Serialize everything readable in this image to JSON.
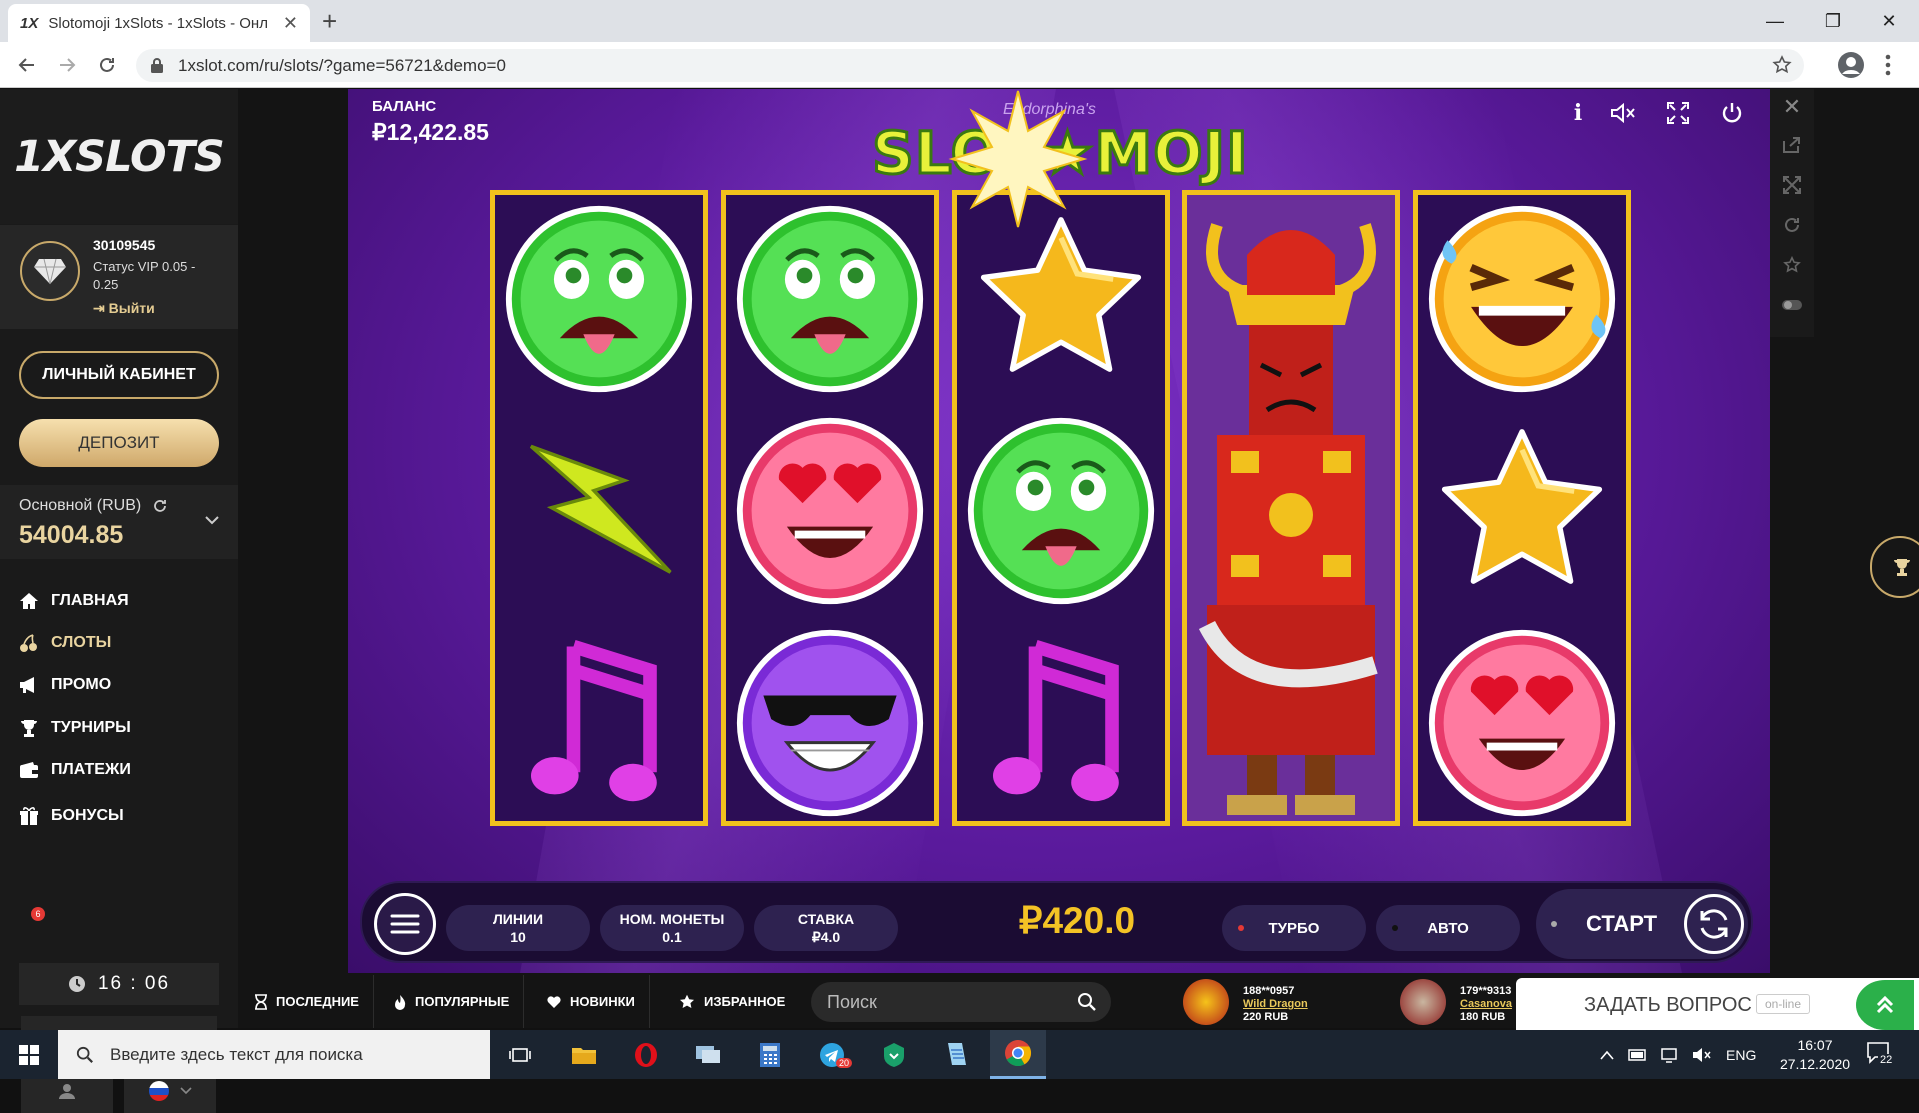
{
  "browser": {
    "tab_title": "Slotomoji 1xSlots - 1xSlots - Онл",
    "tab_favicon": "1X",
    "url": "1xslot.com/ru/slots/?game=56721&demo=0"
  },
  "site": {
    "logo": "1XSLOTS",
    "user": {
      "id": "30109545",
      "status": "Статус VIP 0.05 - 0.25",
      "logout": "Выйти"
    },
    "cabinet_button": "ЛИЧНЫЙ КАБИНЕТ",
    "deposit_button": "ДЕПОЗИТ",
    "account": {
      "label": "Основной (RUB)",
      "balance": "54004.85"
    },
    "nav": [
      {
        "label": "ГЛАВНАЯ",
        "icon": "home-icon"
      },
      {
        "label": "СЛОТЫ",
        "icon": "cherries-icon"
      },
      {
        "label": "ПРОМО",
        "icon": "megaphone-icon"
      },
      {
        "label": "ТУРНИРЫ",
        "icon": "trophy-icon"
      },
      {
        "label": "ПЛАТЕЖИ",
        "icon": "wallet-icon"
      },
      {
        "label": "БОНУСЫ",
        "icon": "gift-icon"
      }
    ],
    "bonus_badge": "6",
    "clock": {
      "hours": "16",
      "sep": ":",
      "minutes": "06"
    }
  },
  "game": {
    "balance_label": "БАЛАНС",
    "balance_value": "₽12,422.85",
    "title": "SLOT★MOJI",
    "subtitle": "Endorphina's",
    "reels": [
      [
        "sick-green-emoji",
        "lightning-symbol",
        "music-note-symbol"
      ],
      [
        "sick-green-emoji",
        "heart-eyes-emoji",
        "sunglasses-emoji"
      ],
      [
        "star-symbol",
        "sick-green-emoji",
        "music-note-symbol"
      ],
      [
        "samurai-wild"
      ],
      [
        "laughing-emoji",
        "star-symbol",
        "heart-eyes-emoji"
      ]
    ],
    "lines": {
      "label": "ЛИНИИ",
      "value": "10"
    },
    "coin": {
      "label": "НОМ. МОНЕТЫ",
      "value": "0.1"
    },
    "stake": {
      "label": "СТАВКА",
      "value": "₽4.0"
    },
    "total_bet": "₽420.0",
    "turbo": "ТУРБО",
    "auto": "АВТО",
    "start": "СТАРТ"
  },
  "bottom": {
    "tabs": [
      "ПОСЛЕДНИЕ",
      "ПОПУЛЯРНЫЕ",
      "НОВИНКИ",
      "ИЗБРАННОЕ"
    ],
    "search_placeholder": "Поиск",
    "winners": [
      {
        "user": "188**0957",
        "game": "Wild Dragon",
        "amount": "220 RUB"
      },
      {
        "user": "179**9313",
        "game": "Casanova",
        "amount": "180 RUB"
      }
    ],
    "ask_question": "ЗАДАТЬ ВОПРОС",
    "online": "on-line"
  },
  "taskbar": {
    "search_placeholder": "Введите здесь текст для поиска",
    "telegram_badge": "20",
    "lang": "ENG",
    "time": "16:07",
    "date": "27.12.2020",
    "notifications": "22"
  },
  "colors": {
    "accent_gold": "#e9d4a0",
    "reel_border": "#f2c11d",
    "game_purple": "#5a1a9c"
  }
}
